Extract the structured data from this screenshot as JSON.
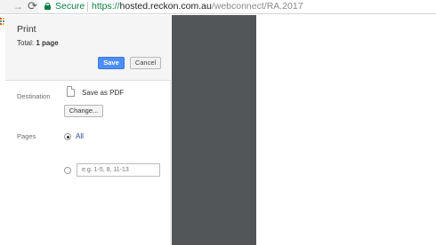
{
  "browser": {
    "security_label": "Secure",
    "url_scheme": "https://",
    "url_host": "hosted.reckon.com.au",
    "url_path": "/webconnect/RA.2017",
    "colors": {
      "secure": "#0b8043"
    }
  },
  "print": {
    "title": "Print",
    "total_prefix": "Total: ",
    "total_value": "1 page",
    "save_label": "Save",
    "cancel_label": "Cancel",
    "destination_label": "Destination",
    "destination_name": "Save as PDF",
    "change_label": "Change...",
    "pages_label": "Pages",
    "pages_all_label": "All",
    "pages_all_selected": true,
    "range_placeholder": "e.g. 1-5, 8, 11-13",
    "colors": {
      "save_button": "#4d8ef8",
      "preview_bg": "#525659"
    }
  }
}
